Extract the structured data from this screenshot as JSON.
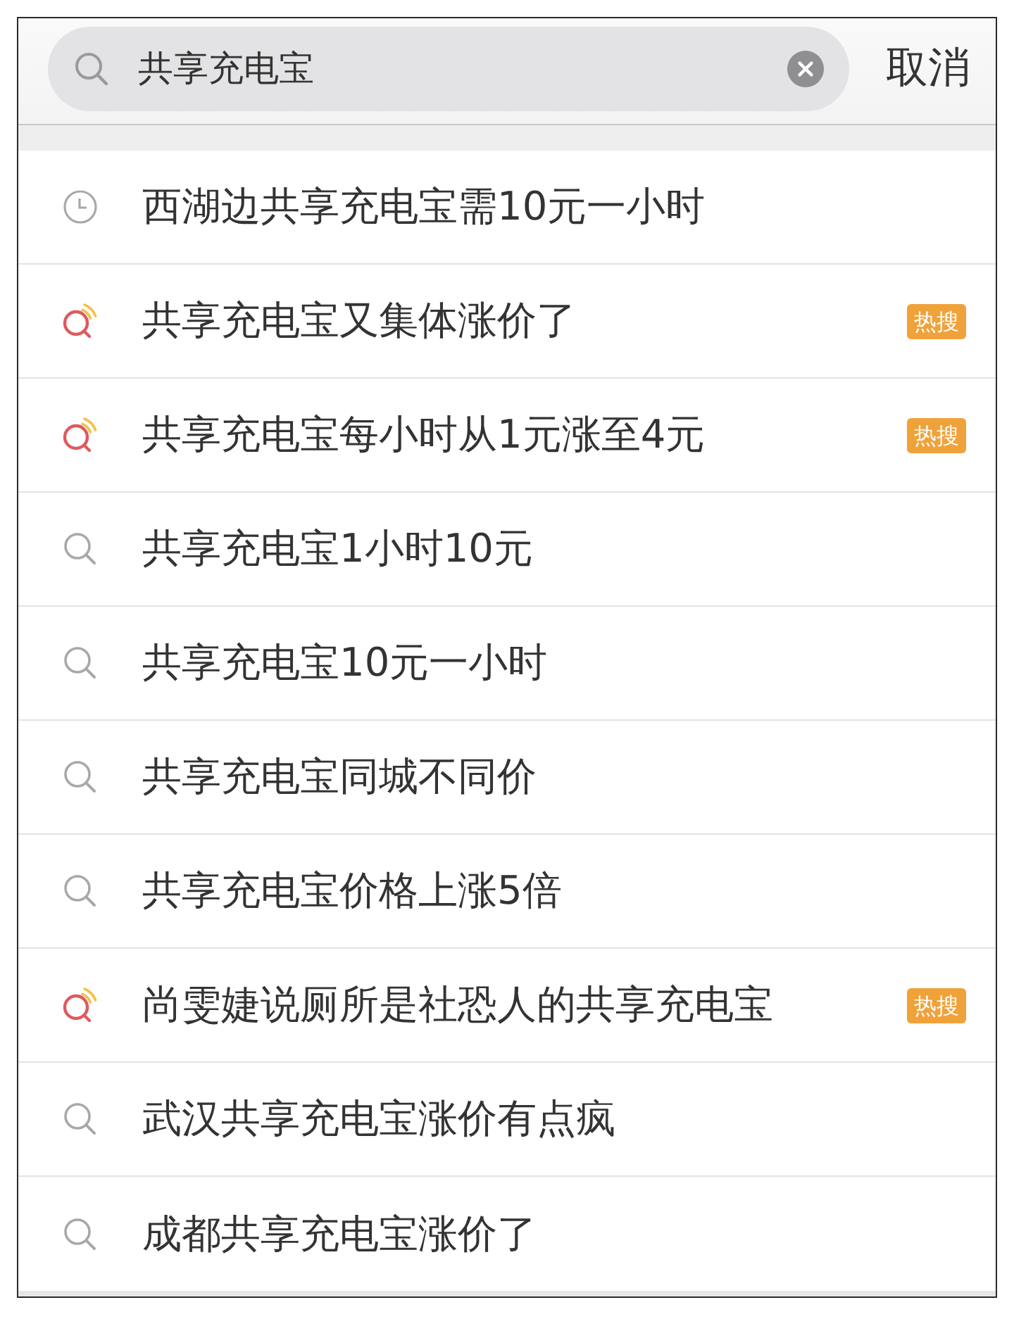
{
  "search_bar": {
    "value": "共享充电宝",
    "cancel": "取消"
  },
  "suggestions": [
    {
      "kind": "history",
      "text": "西湖边共享充电宝需10元一小时"
    },
    {
      "kind": "hot",
      "text": "共享充电宝又集体涨价了",
      "badge": "热搜"
    },
    {
      "kind": "hot",
      "text": "共享充电宝每小时从1元涨至4元",
      "badge": "热搜"
    },
    {
      "kind": "search",
      "text": "共享充电宝1小时10元"
    },
    {
      "kind": "search",
      "text": "共享充电宝10元一小时"
    },
    {
      "kind": "search",
      "text": "共享充电宝同城不同价"
    },
    {
      "kind": "search",
      "text": "共享充电宝价格上涨5倍"
    },
    {
      "kind": "hot",
      "text": "尚雯婕说厕所是社恐人的共享充电宝",
      "badge": "热搜"
    },
    {
      "kind": "search",
      "text": "武汉共享充电宝涨价有点疯"
    },
    {
      "kind": "search",
      "text": "成都共享充电宝涨价了"
    }
  ]
}
